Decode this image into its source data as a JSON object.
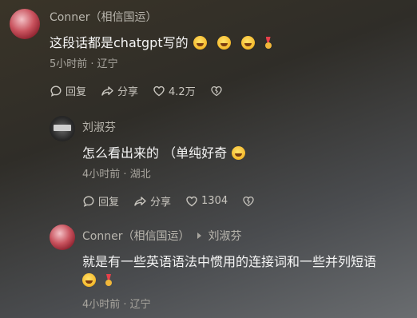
{
  "comments": [
    {
      "name": "Conner（相信国运）",
      "text": "这段话都是chatgpt写的",
      "meta": "5小时前 · 辽宁",
      "reply_label": "回复",
      "share_label": "分享",
      "likes": "4.2万"
    },
    {
      "name": "刘淑芬",
      "text": "怎么看出来的 （单纯好奇",
      "meta": "4小时前 · 湖北",
      "reply_label": "回复",
      "share_label": "分享",
      "likes": "1304"
    },
    {
      "name": "Conner（相信国运）",
      "reply_to": "刘淑芬",
      "text": "就是有一些英语语法中惯用的连接词和一些并列短语",
      "meta": "4小时前 · 辽宁"
    }
  ],
  "icons": {
    "emoji_laugh": "rofl-emoji-icon",
    "medal": "medal-icon",
    "reply": "comment-bubble-icon",
    "share": "share-arrow-icon",
    "like": "heart-icon",
    "dislike": "broken-heart-icon"
  }
}
